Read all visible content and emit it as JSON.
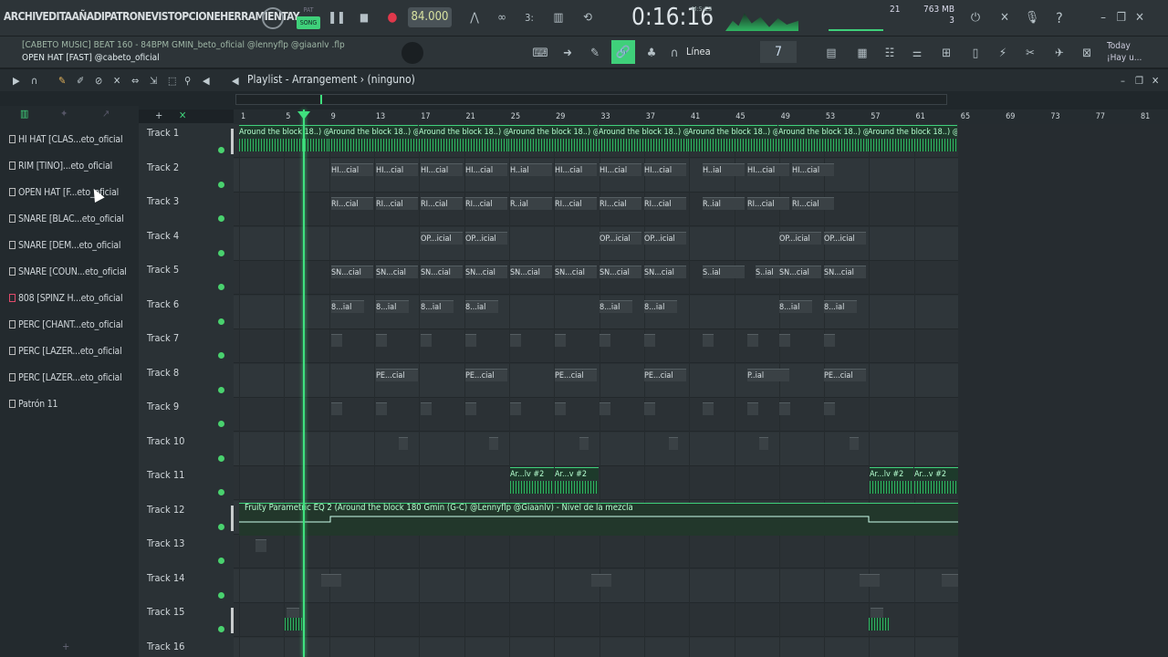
{
  "menu": {
    "items": [
      "ARCHIV",
      "EDITA",
      "AÑADI",
      "PATRONE",
      "VIST",
      "OPCIONE",
      "HERRAMIENTA",
      "Y"
    ]
  },
  "transport": {
    "pat": "PAT",
    "song": "SONG",
    "bpm": "84.000",
    "time": "0:16:16",
    "time_unit": "M:S:CS"
  },
  "status": {
    "cpu": "21",
    "mem": "763 MB",
    "mem2": "3"
  },
  "hint": {
    "line1": "[CABETO MUSIC] BEAT 160 - 84BPM GMIN_beto_oficial @lennyflp @giaanlv .flp",
    "line2": "OPEN HAT [FAST] @cabeto_oficial"
  },
  "toolbar": {
    "snap_mode": "Línea",
    "snap_value": "7",
    "today": "Today",
    "today2": "¡Hay u..."
  },
  "playlist": {
    "title": "Playlist - Arrangement",
    "pattern": "(ninguno)"
  },
  "picker": {
    "items": [
      "HI HAT [CLAS...eto_oficial",
      "RIM [TINO]...eto_oficial",
      "OPEN HAT [F...eto_oficial",
      "SNARE [BLAC...eto_oficial",
      "SNARE [DEM...eto_oficial",
      "SNARE [COUN...eto_oficial",
      "808 [SPINZ H...eto_oficial",
      "PERC [CHANT...eto_oficial",
      "PERC [LAZER...eto_oficial",
      "PERC [LAZER...eto_oficial",
      "Patrón 11"
    ]
  },
  "ruler": {
    "bars": [
      "1",
      "5",
      "9",
      "13",
      "17",
      "21",
      "25",
      "29",
      "33",
      "37",
      "41",
      "45",
      "49",
      "53",
      "57",
      "61",
      "65",
      "69",
      "73",
      "77",
      "81"
    ]
  },
  "tracks": [
    "Track 1",
    "Track 2",
    "Track 3",
    "Track 4",
    "Track 5",
    "Track 6",
    "Track 7",
    "Track 8",
    "Track 9",
    "Track 10",
    "Track 11",
    "Track 12",
    "Track 13",
    "Track 14",
    "Track 15",
    "Track 16"
  ],
  "clips": {
    "t1": "Around the block 18..) @Lennyflp @Giaanlv",
    "t2": [
      "HI...cial",
      "HI...cial",
      "HI...cial",
      "HI...cial",
      "H..ial",
      "HI...cial",
      "HI...cial",
      "HI...cial",
      "H..ial",
      "HI...cial",
      "HI...cial"
    ],
    "t3": [
      "RI...cial",
      "RI...cial",
      "RI...cial",
      "RI...cial",
      "R..ial",
      "RI...cial",
      "RI...cial",
      "RI...cial",
      "R..ial",
      "RI...cial",
      "RI...cial"
    ],
    "t4": [
      "OP...icial",
      "OP...icial",
      "OP...icial",
      "OP...icial",
      "OP...icial",
      "OP...icial"
    ],
    "t5": [
      "SN...cial",
      "SN...cial",
      "SN...cial",
      "SN...cial",
      "SN...cial",
      "SN...cial",
      "SN...cial",
      "SN...cial",
      "S..ial",
      "S..ial",
      "SN...cial",
      "SN...cial"
    ],
    "t6": [
      "8...ial",
      "8...ial",
      "8...ial",
      "8...ial",
      "8...ial",
      "8...ial",
      "8...ial",
      "8...ial"
    ],
    "t8": [
      "PE...cial",
      "PE...cial",
      "PE...cial",
      "PE...cial",
      "P..ial",
      "PE...cial"
    ],
    "t11": [
      "Ar...lv #2",
      "Ar...v #2",
      "Ar...lv #2",
      "Ar...v #2"
    ],
    "t12": "Fruity Parametric EQ 2 (Around the block 180 Gmin (G-C) @Lennyflp @Giaanlv) - Nivel de la mezcla"
  },
  "colors": {
    "accent": "#3fe07e",
    "bg": "#2b3135"
  }
}
